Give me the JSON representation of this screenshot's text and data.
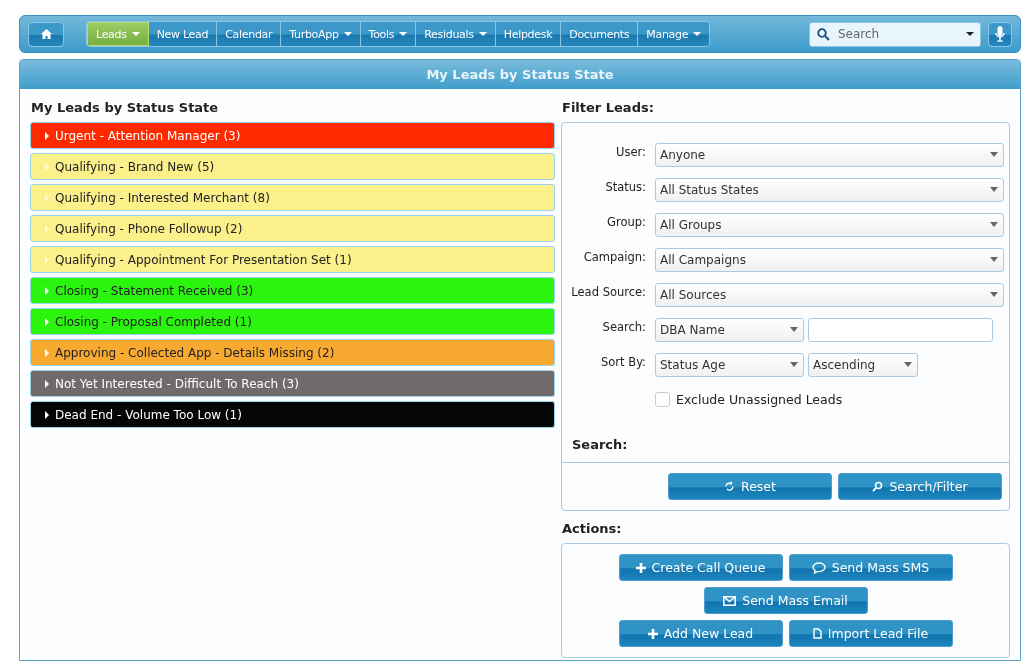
{
  "nav": {
    "items": [
      {
        "label": "Leads",
        "dropdown": true,
        "selected": true
      },
      {
        "label": "New Lead",
        "dropdown": false,
        "selected": false
      },
      {
        "label": "Calendar",
        "dropdown": false,
        "selected": false
      },
      {
        "label": "TurboApp",
        "dropdown": true,
        "selected": false
      },
      {
        "label": "Tools",
        "dropdown": true,
        "selected": false
      },
      {
        "label": "Residuals",
        "dropdown": true,
        "selected": false
      },
      {
        "label": "Helpdesk",
        "dropdown": false,
        "selected": false
      },
      {
        "label": "Documents",
        "dropdown": false,
        "selected": false
      },
      {
        "label": "Manage",
        "dropdown": true,
        "selected": false
      }
    ],
    "search": {
      "placeholder": "Search"
    }
  },
  "panel": {
    "title": "My Leads by Status State"
  },
  "status_list": {
    "heading": "My Leads by Status State",
    "items": [
      {
        "label": "Urgent - Attention Manager (3)",
        "color": "#ff2a00"
      },
      {
        "label": "Qualifying - Brand New (5)",
        "color": "#fcf08a"
      },
      {
        "label": "Qualifying - Interested Merchant (8)",
        "color": "#fcf08a"
      },
      {
        "label": "Qualifying - Phone Followup (2)",
        "color": "#fcf08a"
      },
      {
        "label": "Qualifying - Appointment For Presentation Set (1)",
        "color": "#fcf08a"
      },
      {
        "label": "Closing - Statement Received (3)",
        "color": "#2bf50f"
      },
      {
        "label": "Closing - Proposal Completed (1)",
        "color": "#2bf50f"
      },
      {
        "label": "Approving - Collected App - Details Missing (2)",
        "color": "#f7aa2f"
      },
      {
        "label": "Not Yet Interested - Difficult To Reach (3)",
        "color": "#706b6a"
      },
      {
        "label": "Dead End - Volume Too Low (1)",
        "color": "#050505"
      }
    ]
  },
  "filter": {
    "heading": "Filter Leads:",
    "fields": [
      {
        "kind": "select",
        "label": "User:",
        "value": "Anyone"
      },
      {
        "kind": "select",
        "label": "Status:",
        "value": "All Status States"
      },
      {
        "kind": "select",
        "label": "Group:",
        "value": "All Groups"
      },
      {
        "kind": "select",
        "label": "Campaign:",
        "value": "All Campaigns"
      },
      {
        "kind": "select",
        "label": "Lead Source:",
        "value": "All Sources"
      },
      {
        "kind": "select_input",
        "label": "Search:",
        "value": "DBA Name"
      },
      {
        "kind": "select_pair",
        "label": "Sort By:",
        "value": "Status Age",
        "value2": "Ascending"
      }
    ],
    "checkbox": {
      "label": "Exclude Unassigned Leads",
      "checked": false
    },
    "search_heading": "Search:",
    "buttons": [
      {
        "label": "Reset",
        "kind": "reset"
      },
      {
        "label": "Search/Filter",
        "kind": "search"
      }
    ]
  },
  "actions": {
    "heading": "Actions:",
    "rows": [
      [
        {
          "label": "Create Call Queue",
          "kind": "plus"
        },
        {
          "label": "Send Mass SMS",
          "kind": "chat"
        }
      ],
      [
        {
          "label": "Send Mass Email",
          "kind": "mail"
        }
      ],
      [
        {
          "label": "Add New Lead",
          "kind": "plus"
        },
        {
          "label": "Import Lead File",
          "kind": "file"
        }
      ]
    ]
  }
}
